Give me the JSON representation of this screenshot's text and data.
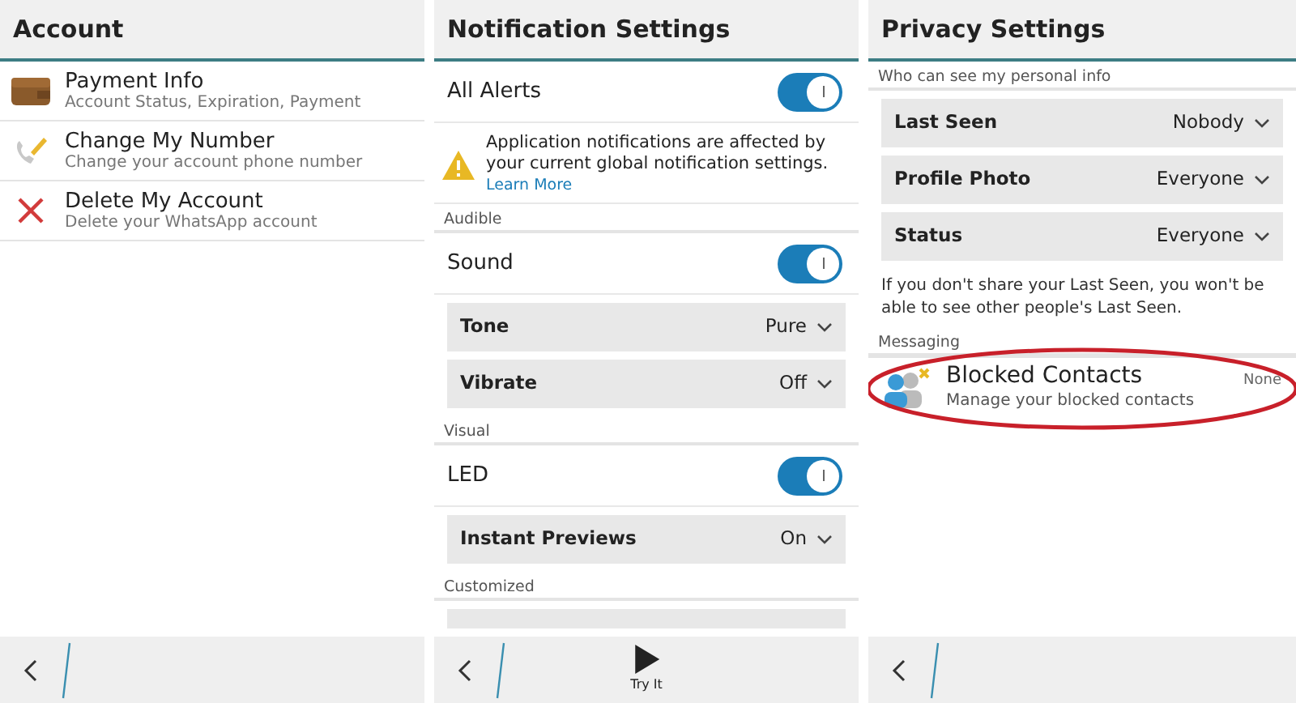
{
  "account": {
    "title": "Account",
    "items": [
      {
        "title": "Payment Info",
        "subtitle": "Account Status, Expiration, Payment"
      },
      {
        "title": "Change My Number",
        "subtitle": "Change your account phone number"
      },
      {
        "title": "Delete My Account",
        "subtitle": "Delete your WhatsApp account"
      }
    ]
  },
  "notification_settings": {
    "title": "Notification Settings",
    "rows": [
      {
        "kind": "toggle",
        "label": "All Alerts",
        "on": true
      },
      {
        "kind": "note",
        "text": "Application notifications are affected by your current global notification settings.",
        "link": "Learn More"
      },
      {
        "kind": "header",
        "label": "Audible"
      },
      {
        "kind": "toggle",
        "label": "Sound",
        "on": true
      },
      {
        "kind": "dropdown",
        "label": "Tone",
        "value": "Pure"
      },
      {
        "kind": "dropdown",
        "label": "Vibrate",
        "value": "Off"
      },
      {
        "kind": "header",
        "label": "Visual"
      },
      {
        "kind": "toggle",
        "label": "LED",
        "on": true
      },
      {
        "kind": "dropdown",
        "label": "Instant Previews",
        "value": "On"
      },
      {
        "kind": "header",
        "label": "Customized"
      },
      {
        "kind": "dropdown_partial"
      }
    ],
    "action": {
      "label": "Try It"
    }
  },
  "privacy_settings": {
    "title": "Privacy Settings",
    "rows": [
      {
        "kind": "header",
        "label": "Who can see my personal info"
      },
      {
        "kind": "dropdown",
        "label": "Last Seen",
        "value": "Nobody"
      },
      {
        "kind": "dropdown",
        "label": "Profile Photo",
        "value": "Everyone"
      },
      {
        "kind": "dropdown",
        "label": "Status",
        "value": "Everyone"
      },
      {
        "kind": "info",
        "text": "If you don't share your Last Seen, you won't be able to see other people's Last Seen."
      },
      {
        "kind": "header",
        "label": "Messaging"
      },
      {
        "kind": "contact_item",
        "title": "Blocked Contacts",
        "subtitle": "Manage your blocked contacts",
        "value": "None",
        "highlighted": true
      }
    ]
  }
}
